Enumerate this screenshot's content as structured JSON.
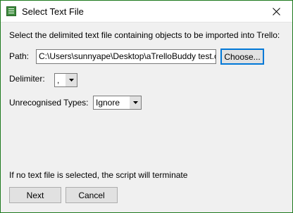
{
  "window": {
    "title": "Select Text File",
    "icon": "text-file-app-icon",
    "close_icon": "close-icon"
  },
  "instructions": "Select the delimited text file containing objects to be imported into Trello:",
  "path": {
    "label": "Path:",
    "value": "C:\\Users\\sunnyape\\Desktop\\aTrelloBuddy test.csv",
    "choose_button": "Choose..."
  },
  "delimiter": {
    "label": "Delimiter:",
    "selected": ","
  },
  "unrecognised_types": {
    "label": "Unrecognised Types:",
    "selected": "Ignore"
  },
  "footer_note": "If no text file is selected, the script will terminate",
  "buttons": {
    "next": "Next",
    "cancel": "Cancel"
  },
  "colors": {
    "window_border": "#1e7a1e",
    "focus_accent": "#0078d7"
  }
}
